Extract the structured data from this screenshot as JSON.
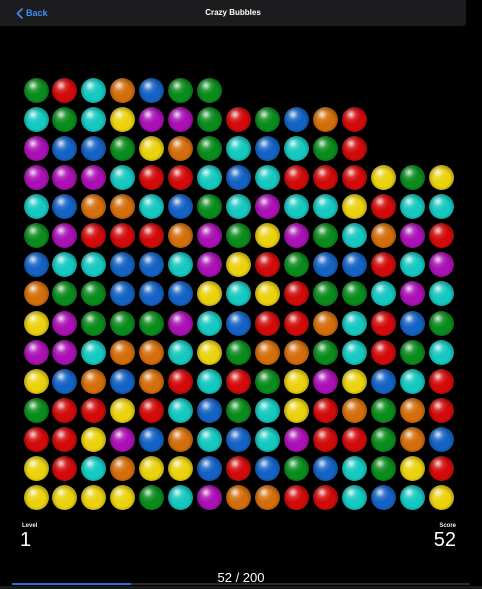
{
  "header": {
    "back_label": "Back",
    "title": "Crazy Bubbles"
  },
  "palette": {
    "G": "#0a8c1d",
    "R": "#d20a0a",
    "C": "#15c8c0",
    "O": "#d46e0c",
    "B": "#1462c4",
    "Y": "#ebd20f",
    "M": "#aa10b4"
  },
  "board": {
    "rows": [
      "GRCOBGG......",
      "CGCYMMGRGBOR.",
      "MBBGYOGCBCGR.",
      "MMMCRRCBCRRRYGY",
      "CBOOCBGCMCCYRCC",
      "GMRRROMGYMGCOMR",
      "BCCBBCMYRGBBRCM",
      "OGGBBBYCYRGGCMC",
      "YMGGGMCBRROCRBG",
      "MMCOOCYGOOGCRGC",
      "YBOBORCRGYMYBCR",
      "GRRYRCBGCYROGOR",
      "RRYMBOCBCMRRGOB",
      "YRCOYYBRBGBCGYR",
      "YYYYGCMOORRCBCY"
    ]
  },
  "stats": {
    "level_label": "Level",
    "level_value": "1",
    "score_label": "Score",
    "score_value": "52"
  },
  "progress": {
    "text": "52 / 200",
    "fraction": 0.26
  }
}
